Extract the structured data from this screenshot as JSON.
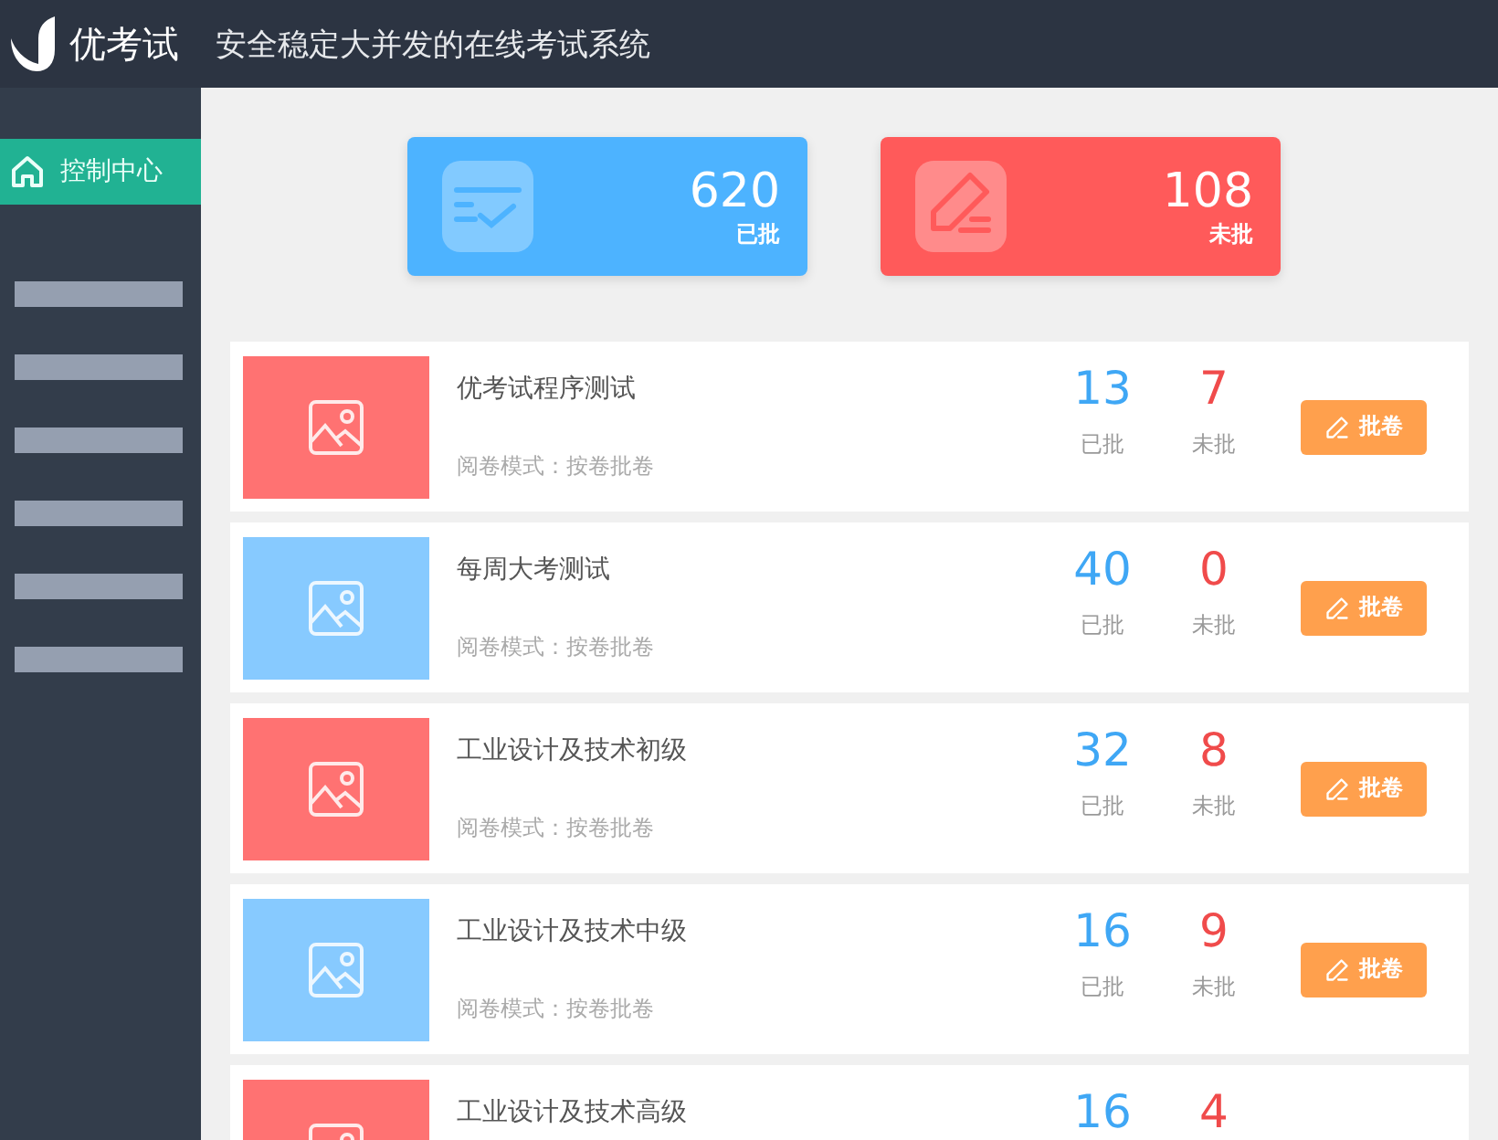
{
  "header": {
    "brand": "优考试",
    "tagline": "安全稳定大并发的在线考试系统"
  },
  "sidebar": {
    "items": [
      {
        "label": "控制中心",
        "selected": true
      }
    ]
  },
  "stats": [
    {
      "value": "620",
      "label": "已批",
      "color": "#4db3ff",
      "kind": "approved"
    },
    {
      "value": "108",
      "label": "未批",
      "color": "#ff5a5a",
      "kind": "pending"
    }
  ],
  "exams": [
    {
      "title": "优考试程序测试",
      "mode": "阅卷模式：按卷批卷",
      "approved": "13",
      "approved_label": "已批",
      "pending": "7",
      "pending_label": "未批",
      "button": "批卷",
      "color": "#ff7272"
    },
    {
      "title": "每周大考测试",
      "mode": "阅卷模式：按卷批卷",
      "approved": "40",
      "approved_label": "已批",
      "pending": "0",
      "pending_label": "未批",
      "button": "批卷",
      "color": "#87caff"
    },
    {
      "title": "工业设计及技术初级",
      "mode": "阅卷模式：按卷批卷",
      "approved": "32",
      "approved_label": "已批",
      "pending": "8",
      "pending_label": "未批",
      "button": "批卷",
      "color": "#ff7272"
    },
    {
      "title": "工业设计及技术中级",
      "mode": "阅卷模式：按卷批卷",
      "approved": "16",
      "approved_label": "已批",
      "pending": "9",
      "pending_label": "未批",
      "button": "批卷",
      "color": "#87caff"
    },
    {
      "title": "工业设计及技术高级",
      "approved": "16",
      "pending": "4",
      "color": "#ff7272"
    }
  ]
}
